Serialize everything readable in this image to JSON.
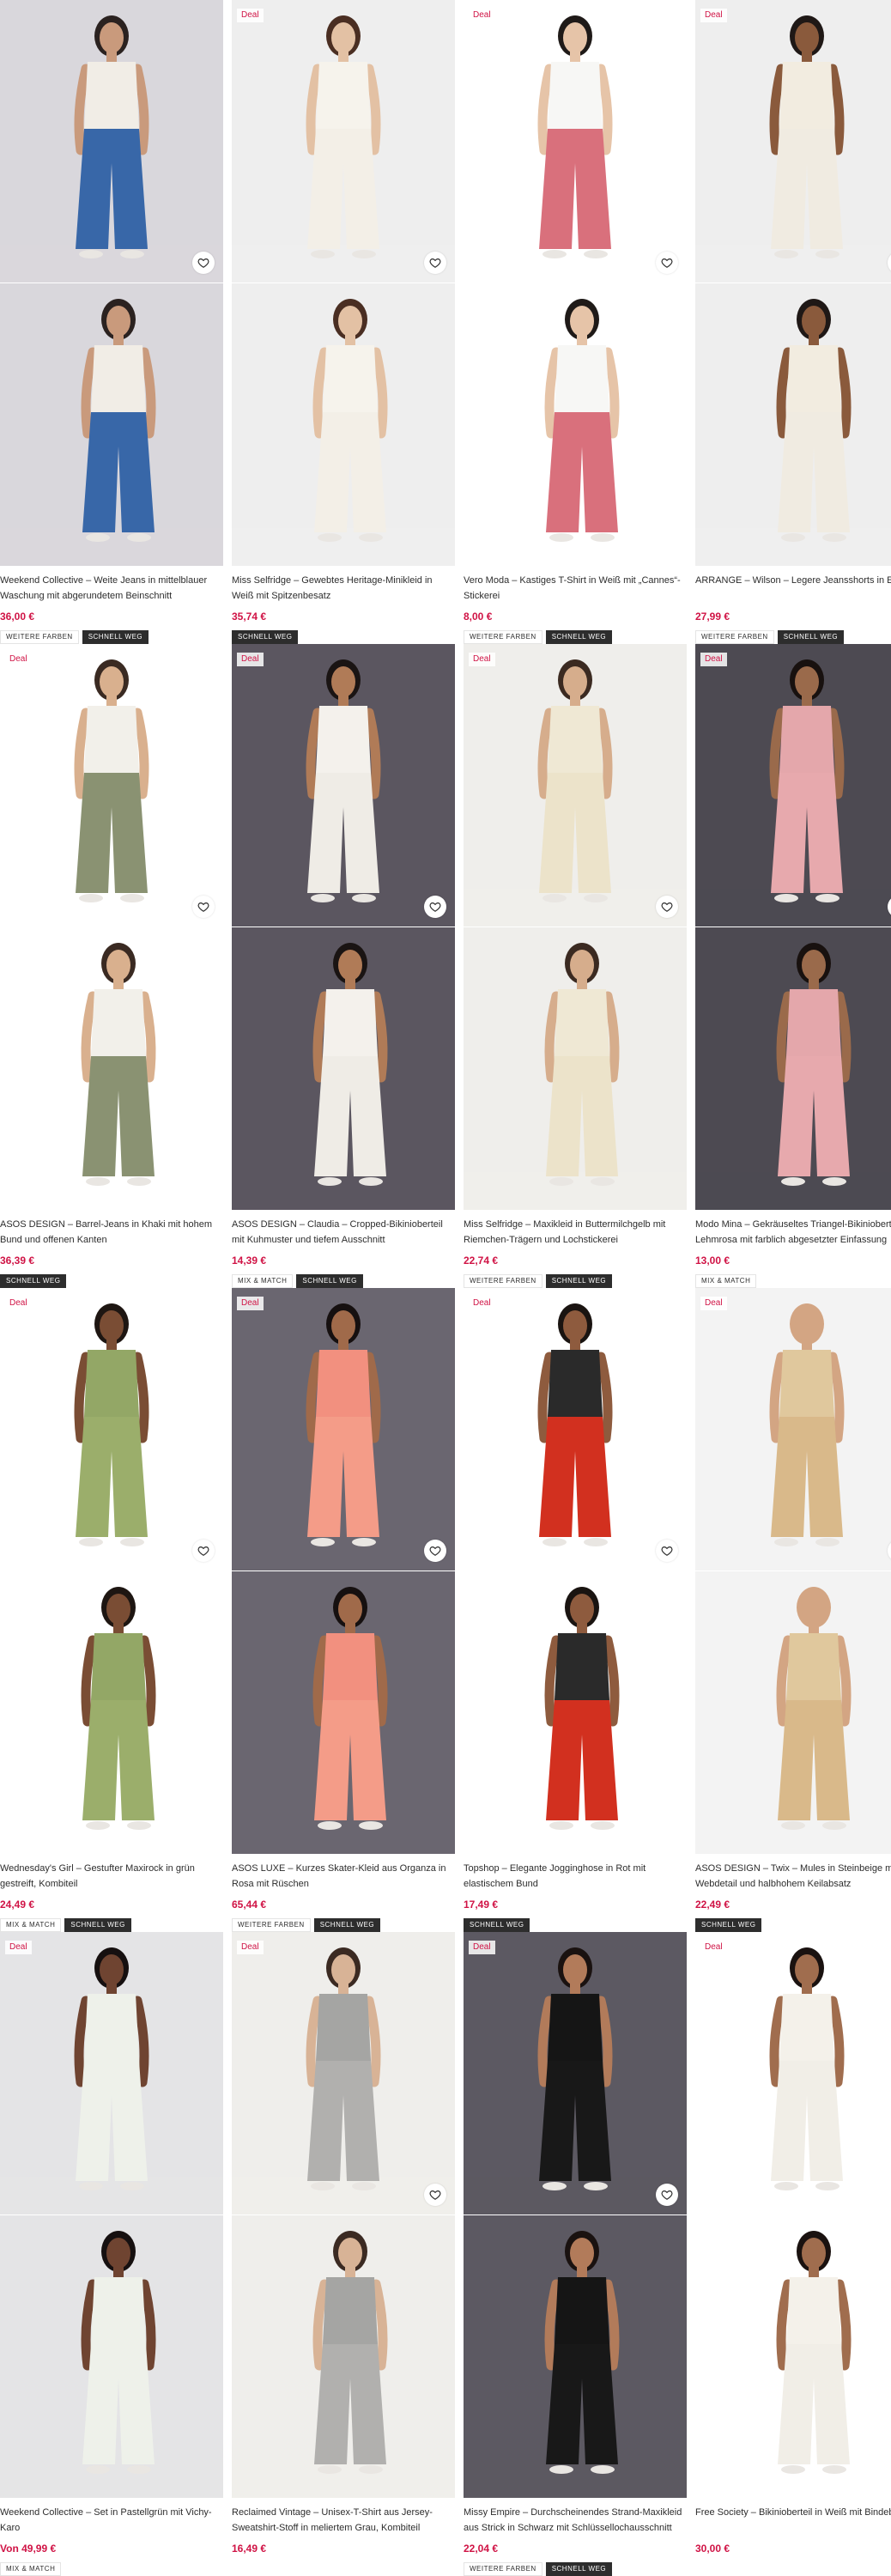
{
  "ui": {
    "deal_label": "Deal"
  },
  "products": [
    {
      "title": "Weekend Collective – Weite Jeans in mittelblauer Waschung mit abgerundetem Beinschnitt",
      "price": "36,00 €",
      "deal": false,
      "heart": true,
      "tags": [
        "WEITERE FARBEN",
        "SCHNELL WEG"
      ],
      "colors": {
        "bg": "#d9d7dc",
        "top": "#f1ede6",
        "bottom": "#3867a8",
        "skin": "#c99a7c",
        "hair": "#2b2220"
      }
    },
    {
      "title": "Miss Selfridge – Gewebtes Heritage-Minikleid in Weiß mit Spitzenbesatz",
      "price": "35,74 €",
      "deal": true,
      "heart": true,
      "tags": [
        "SCHNELL WEG"
      ],
      "colors": {
        "bg": "#eeeeee",
        "top": "#f6f3ec",
        "bottom": "#f3efe7",
        "skin": "#e3c1a4",
        "hair": "#4a2e22"
      }
    },
    {
      "title": "Vero Moda – Kastiges T-Shirt in Weiß mit „Cannes“-Stickerei",
      "price": "8,00 €",
      "deal": true,
      "heart": true,
      "tags": [
        "WEITERE FARBEN",
        "SCHNELL WEG"
      ],
      "colors": {
        "bg": "#ffffff",
        "top": "#f7f7f5",
        "bottom": "#d9707c",
        "skin": "#e6c4a8",
        "hair": "#1f1a18"
      }
    },
    {
      "title": "ARRANGE – Wilson – Legere Jeansshorts in Ecru",
      "price": "27,99 €",
      "deal": true,
      "heart": true,
      "tags": [
        "WEITERE FARBEN",
        "SCHNELL WEG"
      ],
      "colors": {
        "bg": "#eeeeee",
        "top": "#f2ece0",
        "bottom": "#f0ebe1",
        "skin": "#8a5a3c",
        "hair": "#1f1816"
      }
    },
    {
      "title": "ASOS DESIGN – Barrel-Jeans in Khaki mit hohem Bund und offenen Kanten",
      "price": "36,39 €",
      "deal": true,
      "heart": true,
      "tags": [
        "SCHNELL WEG"
      ],
      "colors": {
        "bg": "#ffffff",
        "top": "#f2f0ea",
        "bottom": "#8a9272",
        "skin": "#d9b08e",
        "hair": "#3a2a22"
      }
    },
    {
      "title": "ASOS DESIGN – Claudia – Cropped-Bikinioberteil mit Kuhmuster und tiefem Ausschnitt",
      "price": "14,39 €",
      "deal": true,
      "heart": true,
      "tags": [
        "MIX & MATCH",
        "SCHNELL WEG"
      ],
      "colors": {
        "bg": "#5b5660",
        "top": "#f4f1ec",
        "bottom": "#efece6",
        "skin": "#b07b57",
        "hair": "#1a1413"
      }
    },
    {
      "title": "Miss Selfridge – Maxikleid in Buttermilchgelb mit Riemchen-Trägern und Lochstickerei",
      "price": "22,74 €",
      "deal": true,
      "heart": true,
      "tags": [
        "WEITERE FARBEN",
        "SCHNELL WEG"
      ],
      "colors": {
        "bg": "#efeeeb",
        "top": "#efe8d4",
        "bottom": "#ece3ca",
        "skin": "#d6ad8c",
        "hair": "#3b2a21"
      }
    },
    {
      "title": "Modo Mina – Gekräuseltes Triangel-Bikinioberteil in Lehmrosa mit farblich abgesetzter Einfassung",
      "price": "13,00 €",
      "deal": true,
      "heart": true,
      "tags": [
        "MIX & MATCH"
      ],
      "colors": {
        "bg": "#4d4a52",
        "top": "#e4a7ab",
        "bottom": "#e7a9ad",
        "skin": "#9a6a4b",
        "hair": "#18110f"
      }
    },
    {
      "title": "Wednesday's Girl – Gestufter Maxirock in grün gestreift, Kombiteil",
      "price": "24,49 €",
      "deal": true,
      "heart": true,
      "tags": [
        "MIX & MATCH",
        "SCHNELL WEG"
      ],
      "colors": {
        "bg": "#ffffff",
        "top": "#93a766",
        "bottom": "#9bae6b",
        "skin": "#7a4d34",
        "hair": "#1e1612"
      }
    },
    {
      "title": "ASOS LUXE – Kurzes Skater-Kleid aus Organza in Rosa mit Rüschen",
      "price": "65,44 €",
      "deal": true,
      "heart": true,
      "tags": [
        "WEITERE FARBEN",
        "SCHNELL WEG"
      ],
      "colors": {
        "bg": "#6a6670",
        "top": "#f2907f",
        "bottom": "#f49c88",
        "skin": "#a06a4a",
        "hair": "#161010"
      }
    },
    {
      "title": "Topshop – Elegante Jogginghose in Rot mit elastischem Bund",
      "price": "17,49 €",
      "deal": true,
      "heart": true,
      "tags": [
        "SCHNELL WEG"
      ],
      "colors": {
        "bg": "#ffffff",
        "top": "#2a2a2a",
        "bottom": "#d2301f",
        "skin": "#8e5b3e",
        "hair": "#1a1411"
      }
    },
    {
      "title": "ASOS DESIGN – Twix – Mules in Steinbeige mit Webdetail und halbhohem Keilabsatz",
      "price": "22,49 €",
      "deal": true,
      "heart": true,
      "tags": [
        "SCHNELL WEG"
      ],
      "colors": {
        "bg": "#f3f3f3",
        "top": "#e0c89d",
        "bottom": "#d9b98a",
        "skin": "#d3a583",
        "hair": "#d3a583"
      }
    },
    {
      "title": "Weekend Collective – Set in Pastellgrün mit Vichy-Karo",
      "price": "Von 49,99 €",
      "deal": true,
      "heart": false,
      "tags": [
        "MIX & MATCH"
      ],
      "colors": {
        "bg": "#e4e4e6",
        "top": "#eef1ea",
        "bottom": "#eef1ea",
        "skin": "#6f4431",
        "hair": "#161010"
      }
    },
    {
      "title": "Reclaimed Vintage – Unisex-T-Shirt aus Jersey-Sweatshirt-Stoff in meliertem Grau, Kombiteil",
      "price": "16,49 €",
      "deal": true,
      "heart": true,
      "tags": [],
      "colors": {
        "bg": "#efeeeb",
        "top": "#a5a5a3",
        "bottom": "#b1b0ae",
        "skin": "#d8b396",
        "hair": "#3b2a22"
      }
    },
    {
      "title": "Missy Empire – Durchscheinendes Strand-Maxikleid aus Strick in Schwarz mit Schlüssellochausschnitt",
      "price": "22,04 €",
      "deal": true,
      "heart": true,
      "tags": [
        "WEITERE FARBEN",
        "SCHNELL WEG"
      ],
      "colors": {
        "bg": "#5c5962",
        "top": "#151515",
        "bottom": "#181818",
        "skin": "#b27b5a",
        "hair": "#1a1210"
      }
    },
    {
      "title": "Free Society – Bikinioberteil in Weiß mit Bindeband",
      "price": "30,00 €",
      "deal": true,
      "heart": false,
      "tags": [],
      "colors": {
        "bg": "#ffffff",
        "top": "#f4f1ea",
        "bottom": "#f1eee7",
        "skin": "#a06d4e",
        "hair": "#1a1210"
      }
    }
  ]
}
